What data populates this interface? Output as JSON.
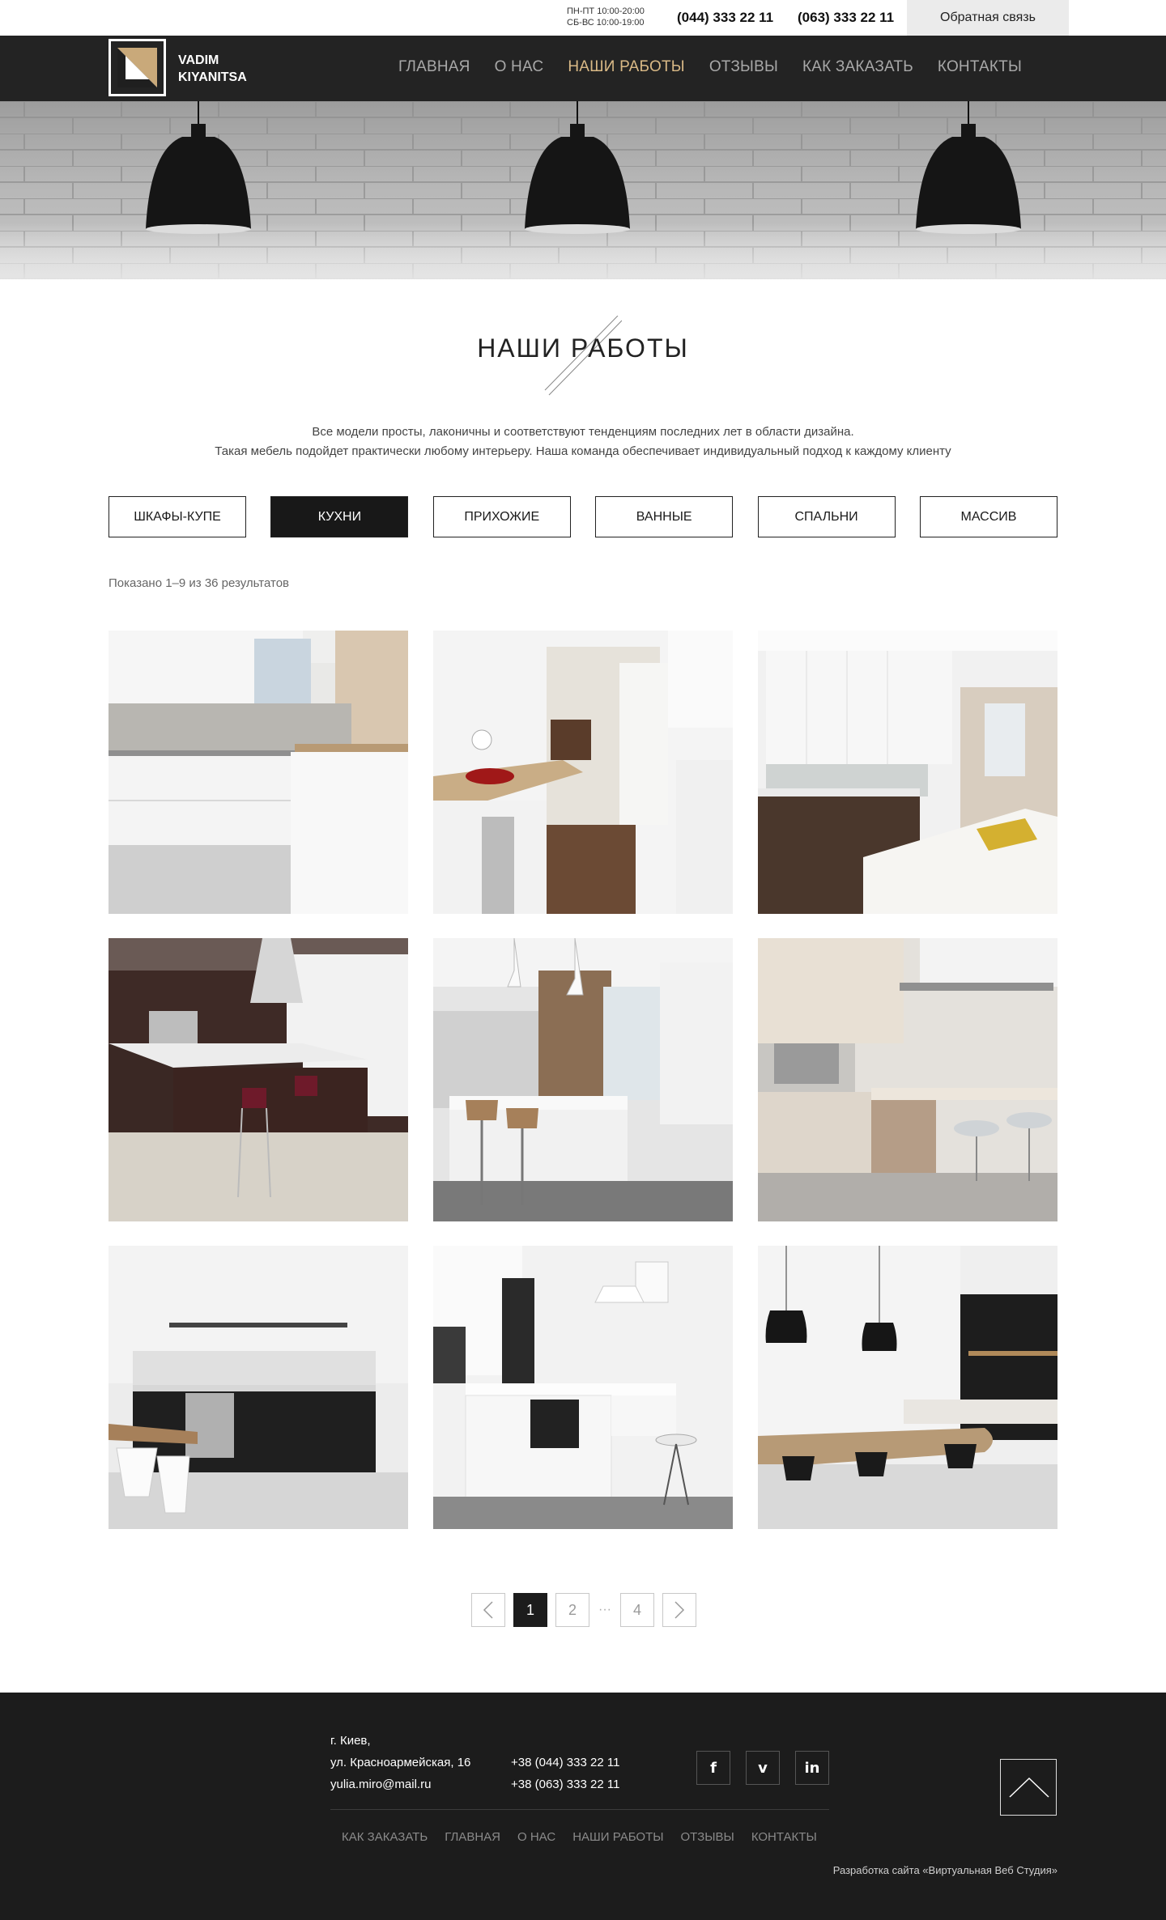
{
  "topbar": {
    "hours_weekdays": "ПН-ПТ 10:00-20:00",
    "hours_weekend": "СБ-ВС 10:00-19:00",
    "phone_1": "(044) 333 22 11",
    "phone_2": "(063) 333 22 11",
    "feedback_label": "Обратная связь"
  },
  "brand": {
    "line_1": "VADIM",
    "line_2": "KIYANITSA"
  },
  "nav": {
    "items": [
      {
        "label": "ГЛАВНАЯ"
      },
      {
        "label": "О НАС"
      },
      {
        "label": "НАШИ РАБОТЫ"
      },
      {
        "label": "ОТЗЫВЫ"
      },
      {
        "label": "КАК ЗАКАЗАТЬ"
      },
      {
        "label": "КОНТАКТЫ"
      }
    ],
    "active_index": 2,
    "active_color": "#d9b986"
  },
  "main": {
    "title": "НАШИ РАБОТЫ",
    "intro_line_1": "Все модели просты, лаконичны и соответствуют тенденциям последних лет в области дизайна.",
    "intro_line_2": "Такая мебель подойдет практически любому интерьеру. Наша команда обеспечивает индивидуальный подход к каждому клиенту",
    "filters": [
      {
        "label": "ШКАФЫ-КУПЕ"
      },
      {
        "label": "КУХНИ"
      },
      {
        "label": "ПРИХОЖИЕ"
      },
      {
        "label": "ВАННЫЕ"
      },
      {
        "label": "СПАЛЬНИ"
      },
      {
        "label": "МАССИВ"
      }
    ],
    "active_filter_index": 1,
    "results_text": "Показано 1–9 из 36 результатов"
  },
  "pagination": {
    "prev_icon": "chevron-left-icon",
    "next_icon": "chevron-right-icon",
    "pages": [
      "1",
      "2",
      "4"
    ],
    "ellipsis": "···",
    "current": "1"
  },
  "footer": {
    "city": "г. Киев,",
    "street": "ул. Красноармейская, 16",
    "email": "yulia.miro@mail.ru",
    "phone_1": "+38 (044) 333 22 11",
    "phone_2": "+38 (063) 333 22 11",
    "social": [
      {
        "icon": "facebook-icon",
        "glyph": "f"
      },
      {
        "icon": "vimeo-icon",
        "glyph": "v"
      },
      {
        "icon": "linkedin-icon",
        "glyph": "in"
      }
    ],
    "nav": [
      {
        "label": "КАК ЗАКАЗАТЬ"
      },
      {
        "label": "ГЛАВНАЯ"
      },
      {
        "label": "О НАС"
      },
      {
        "label": "НАШИ РАБОТЫ"
      },
      {
        "label": "ОТЗЫВЫ"
      },
      {
        "label": "КОНТАКТЫ"
      }
    ],
    "credit": "Разработка сайта «Виртуальная Веб Студия»"
  },
  "colors": {
    "nav_background": "#232323",
    "footer_background": "#1c1c1c",
    "accent": "#d9b986",
    "logo_gold": "#c9a97a"
  }
}
